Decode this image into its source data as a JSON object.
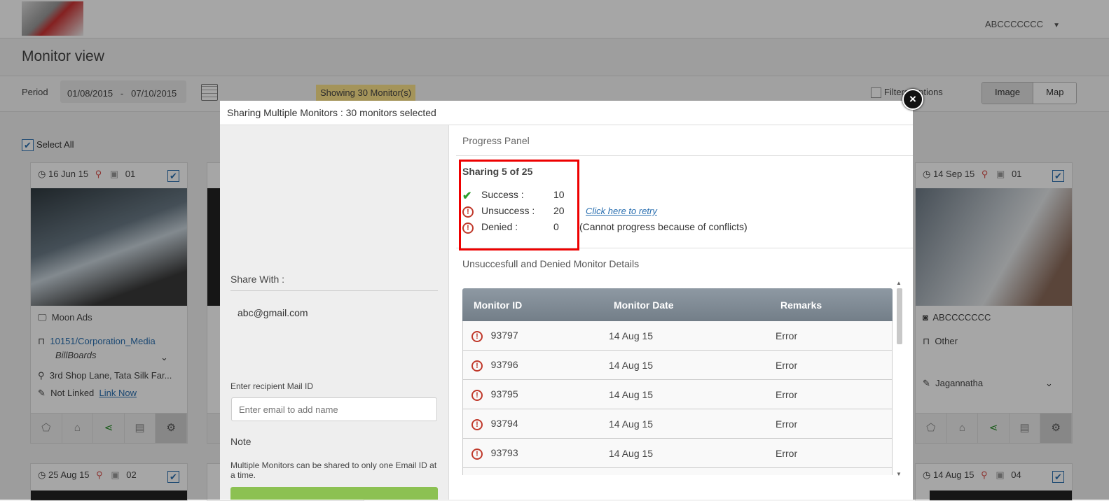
{
  "user": {
    "name": "ABCCCCCCC"
  },
  "page": {
    "title": "Monitor view"
  },
  "period": {
    "label": "Period",
    "from": "01/08/2015",
    "separator": "-",
    "to": "07/10/2015"
  },
  "showing": "Showing 30 Monitor(s)",
  "filters_label": "Filters Options",
  "view_toggle": {
    "image": "Image",
    "map": "Map",
    "active": "Image"
  },
  "select_all": "Select All",
  "cards": [
    {
      "date": "16 Jun 15",
      "count": "01",
      "name": "Moon Ads",
      "code": "10151/Corporation_Media",
      "type": "BillBoards",
      "address": "3rd Shop Lane, Tata Silk Far...",
      "link_status": "Not Linked",
      "link_action": "Link Now"
    },
    {
      "date": "14 Sep 15",
      "count": "01",
      "name": "ABCCCCCCC",
      "code": "Other",
      "owner": "Jagannatha"
    },
    {
      "date": "25 Aug 15",
      "count": "02"
    },
    {
      "date": "14 Aug 15",
      "count": "04"
    }
  ],
  "modal": {
    "title": "Sharing Multiple Monitors : 30 monitors selected",
    "share_with_label": "Share With :",
    "share_with_email": "abc@gmail.com",
    "recipient_label": "Enter recipient Mail ID",
    "recipient_placeholder": "Enter email to add name",
    "note_title": "Note",
    "note_text": "Multiple Monitors can be shared to only one Email ID at a time.",
    "progress_title": "Progress Panel",
    "sharing_status": "Sharing 5 of 25",
    "stats": [
      {
        "label": "Success :",
        "value": "10",
        "icon": "check-icon",
        "extra": ""
      },
      {
        "label": "Unsuccess :",
        "value": "20",
        "icon": "error-icon",
        "extra": "Click here to retry"
      },
      {
        "label": "Denied :",
        "value": "0",
        "icon": "error-icon",
        "extra": "(Cannot progress because of conflicts)"
      }
    ],
    "details_title": "Unsuccesfull and Denied Monitor Details",
    "table_headers": [
      "Monitor ID",
      "Monitor Date",
      "Remarks"
    ],
    "rows": [
      {
        "id": "93797",
        "date": "14 Aug 15",
        "remark": "Error"
      },
      {
        "id": "93796",
        "date": "14 Aug 15",
        "remark": "Error"
      },
      {
        "id": "93795",
        "date": "14 Aug 15",
        "remark": "Error"
      },
      {
        "id": "93794",
        "date": "14 Aug 15",
        "remark": "Error"
      },
      {
        "id": "93793",
        "date": "14 Aug 15",
        "remark": "Error"
      }
    ]
  },
  "colors": {
    "accent": "#2a6fb0",
    "success": "#2e9e2e",
    "error": "#c0392b",
    "highlight": "#fce38a",
    "share_button": "#8cc152"
  }
}
